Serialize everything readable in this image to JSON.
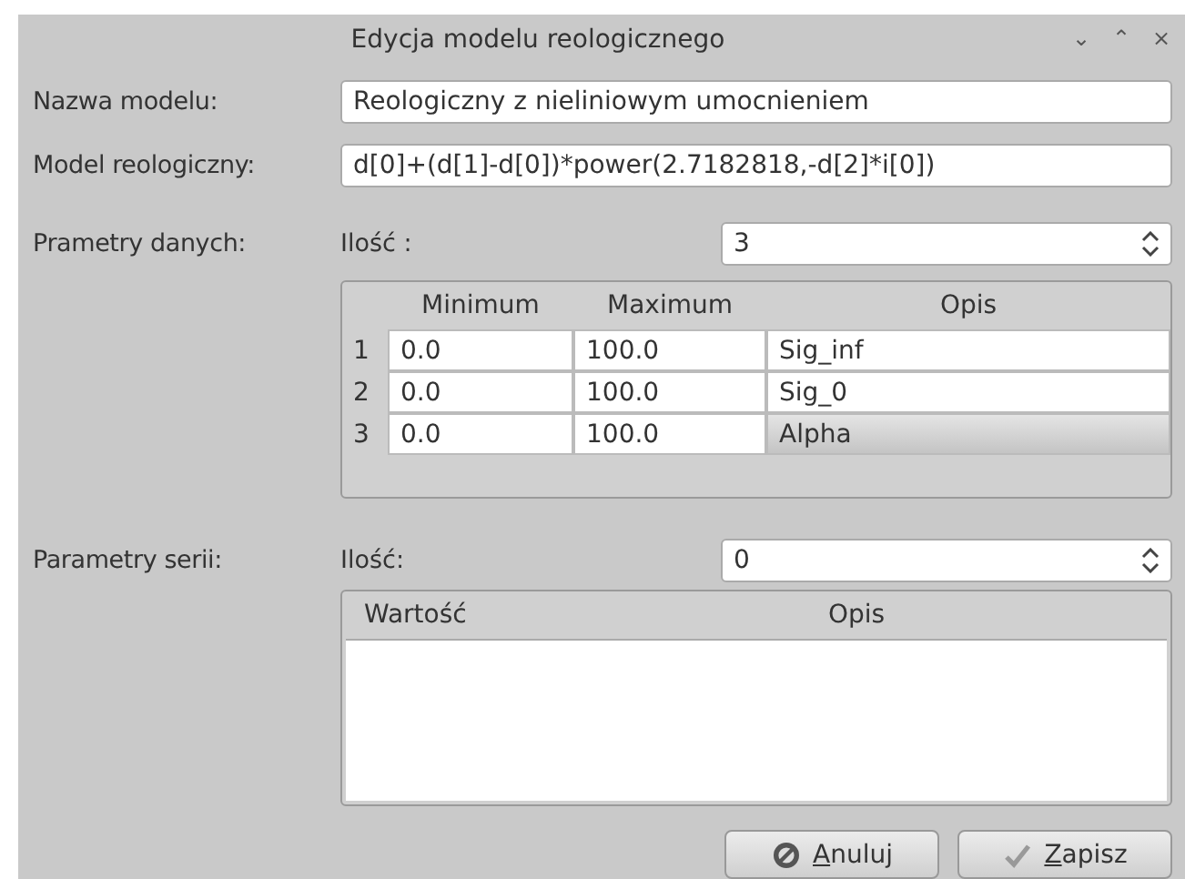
{
  "window": {
    "title": "Edycja modelu reologicznego",
    "controls": [
      "⌄",
      "⌃",
      "×"
    ]
  },
  "fields": [
    {
      "label": "Nazwa modelu:",
      "value": "Reologiczny z nieliniowym umocnieniem"
    },
    {
      "label": "Model reologiczny:",
      "value": "d[0]+(d[1]-d[0])*power(2.7182818,-d[2]*i[0])"
    }
  ],
  "data_params": {
    "label": "Prametry danych:",
    "count_label": "Ilość :",
    "count": "3",
    "table": {
      "columns": [
        "Minimum",
        "Maximum",
        "Opis"
      ],
      "rows": [
        {
          "number": "1",
          "cells": [
            "0.0",
            "100.0",
            "Sig_inf"
          ],
          "selected": false
        },
        {
          "number": "2",
          "cells": [
            "0.0",
            "100.0",
            "Sig_0"
          ],
          "selected": false
        },
        {
          "number": "3",
          "cells": [
            "0.0",
            "100.0",
            "Alpha"
          ],
          "selected": true
        }
      ]
    }
  },
  "series_params": {
    "label": "Parametry serii:",
    "count_label": "Ilość:",
    "count": "0",
    "table": {
      "columns": [
        "Wartość",
        "Opis"
      ]
    }
  },
  "buttons": [
    {
      "label": "Anuluj",
      "kind": "cancel"
    },
    {
      "label": "Zapisz",
      "kind": "save"
    }
  ]
}
